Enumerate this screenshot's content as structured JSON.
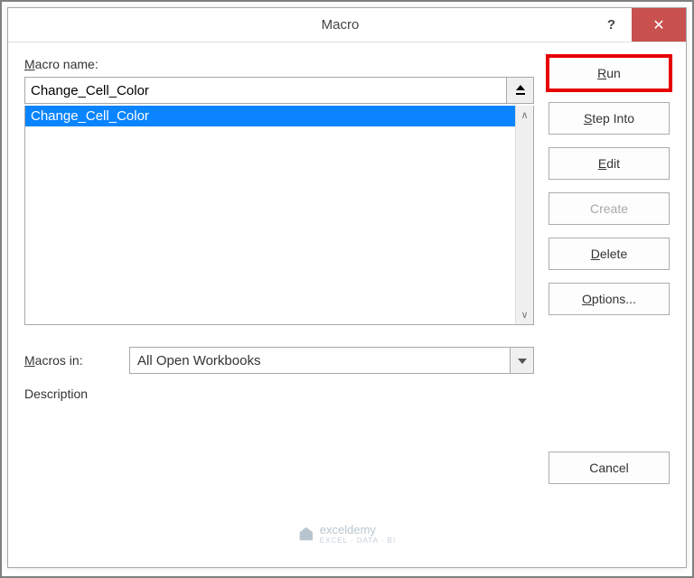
{
  "titlebar": {
    "title": "Macro",
    "help": "?",
    "close": "✕"
  },
  "labels": {
    "macro_name": "acro name:",
    "macro_name_prefix": "M",
    "macros_in_prefix": "M",
    "macros_in": "acros in:",
    "description": "Description"
  },
  "fields": {
    "macro_name_value": "Change_Cell_Color",
    "macros_in_value": "All Open Workbooks"
  },
  "list": {
    "items": [
      "Change_Cell_Color"
    ]
  },
  "buttons": {
    "run_prefix": "R",
    "run": "un",
    "step_into_prefix": "S",
    "step_into": "tep Into",
    "edit_prefix": "E",
    "edit": "dit",
    "create": "Create",
    "delete_prefix": "D",
    "delete": "elete",
    "options_prefix": "O",
    "options": "ptions...",
    "cancel": "Cancel"
  },
  "watermark": {
    "name": "exceldemy",
    "sub": "EXCEL · DATA · BI"
  }
}
